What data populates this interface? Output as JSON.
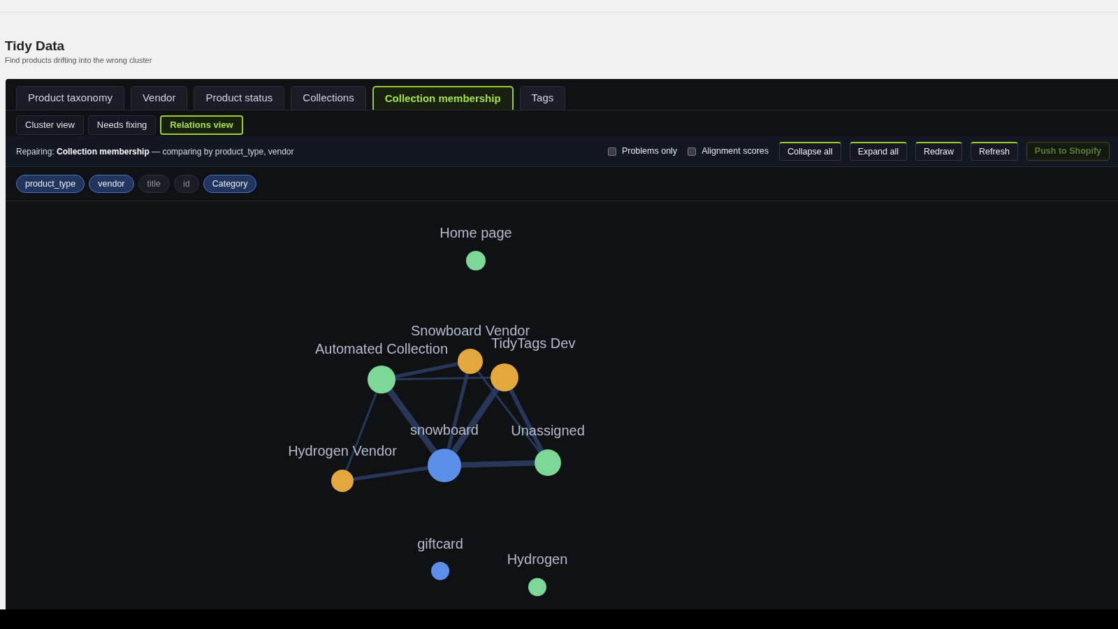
{
  "header": {
    "title": "Tidy Data",
    "subtitle": "Find products drifting into the wrong cluster"
  },
  "tabs": [
    {
      "label": "Product taxonomy",
      "selected": false
    },
    {
      "label": "Vendor",
      "selected": false
    },
    {
      "label": "Product status",
      "selected": false
    },
    {
      "label": "Collections",
      "selected": false
    },
    {
      "label": "Collection membership",
      "selected": true
    },
    {
      "label": "Tags",
      "selected": false
    }
  ],
  "views": [
    {
      "label": "Cluster view",
      "selected": false
    },
    {
      "label": "Needs fixing",
      "selected": false
    },
    {
      "label": "Relations view",
      "selected": true
    }
  ],
  "toolbar": {
    "text": "Repairing: **Collection membership** — comparing by product_type, vendor",
    "checkboxes": [
      {
        "label": "Problems only",
        "checked": false
      },
      {
        "label": "Alignment scores",
        "checked": false
      }
    ],
    "buttons": [
      {
        "label": "Collapse all",
        "disabled": false
      },
      {
        "label": "Expand all",
        "disabled": false
      },
      {
        "label": "Redraw",
        "disabled": false
      },
      {
        "label": "Refresh",
        "disabled": false
      },
      {
        "label": "Push to Shopify",
        "disabled": true
      }
    ]
  },
  "fields": [
    {
      "label": "product_type",
      "selected": true
    },
    {
      "label": "vendor",
      "selected": true
    },
    {
      "label": "title",
      "selected": false
    },
    {
      "label": "id",
      "selected": false
    },
    {
      "label": "Category",
      "selected": true
    }
  ],
  "graph": {
    "nodes": [
      {
        "label": "Home page",
        "color": "#7dd897"
      },
      {
        "label": "Automated Collection",
        "color": "#7dd897"
      },
      {
        "label": "Snowboard Vendor",
        "color": "#e2a83e"
      },
      {
        "label": "TidyTags Dev",
        "color": "#e2a83e"
      },
      {
        "label": "snowboard",
        "color": "#5b8fe8"
      },
      {
        "label": "Unassigned",
        "color": "#7dd897"
      },
      {
        "label": "Hydrogen Vendor",
        "color": "#e2a83e"
      },
      {
        "label": "giftcard",
        "color": "#5b8fe8"
      },
      {
        "label": "Hydrogen",
        "color": "#7dd897"
      }
    ]
  }
}
